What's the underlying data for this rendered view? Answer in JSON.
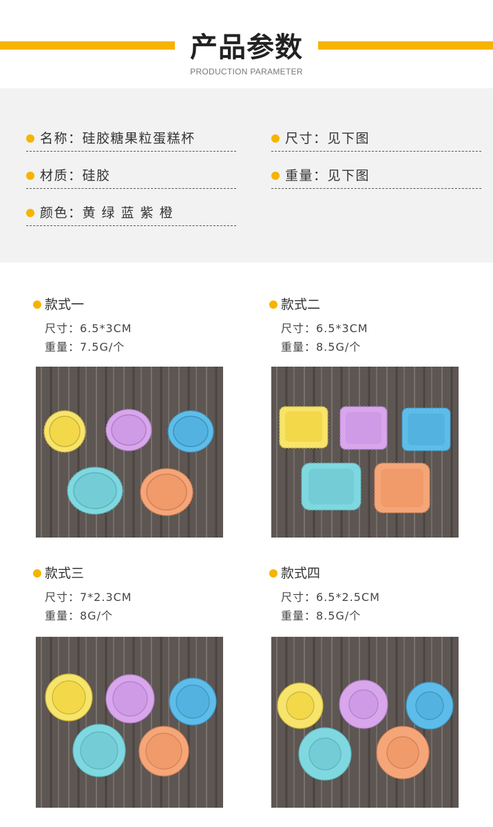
{
  "header": {
    "title": "产品参数",
    "subtitle": "PRODUCTION PARAMETER",
    "accent_color": "#f6b400"
  },
  "params": [
    {
      "text": "名称：硅胶糖果粒蛋糕杯"
    },
    {
      "text": "尺寸：见下图"
    },
    {
      "text": "材质：硅胶"
    },
    {
      "text": "重量：见下图"
    },
    {
      "text": "颜色：黄 绿 蓝 紫 橙"
    }
  ],
  "variants": [
    {
      "name": "款式一",
      "size": "尺寸：6.5*3CM",
      "weight": "重量：7.5G/个",
      "photo_icon": "round-cupcake-liners-photo"
    },
    {
      "name": "款式二",
      "size": "尺寸：6.5*3CM",
      "weight": "重量：8.5G/个",
      "photo_icon": "square-cupcake-liners-photo"
    },
    {
      "name": "款式三",
      "size": "尺寸：7*2.3CM",
      "weight": "重量：8G/个",
      "photo_icon": "flower-cupcake-liners-photo"
    },
    {
      "name": "款式四",
      "size": "尺寸：6.5*2.5CM",
      "weight": "重量：8.5G/个",
      "photo_icon": "flower-cupcake-liners-tall-photo"
    }
  ],
  "colors": {
    "yellow": "#f7e46b",
    "purple": "#d8a6ea",
    "blue": "#5ebde8",
    "mint": "#7fd8e0",
    "orange": "#f5a679",
    "wood": "#5d5652"
  }
}
